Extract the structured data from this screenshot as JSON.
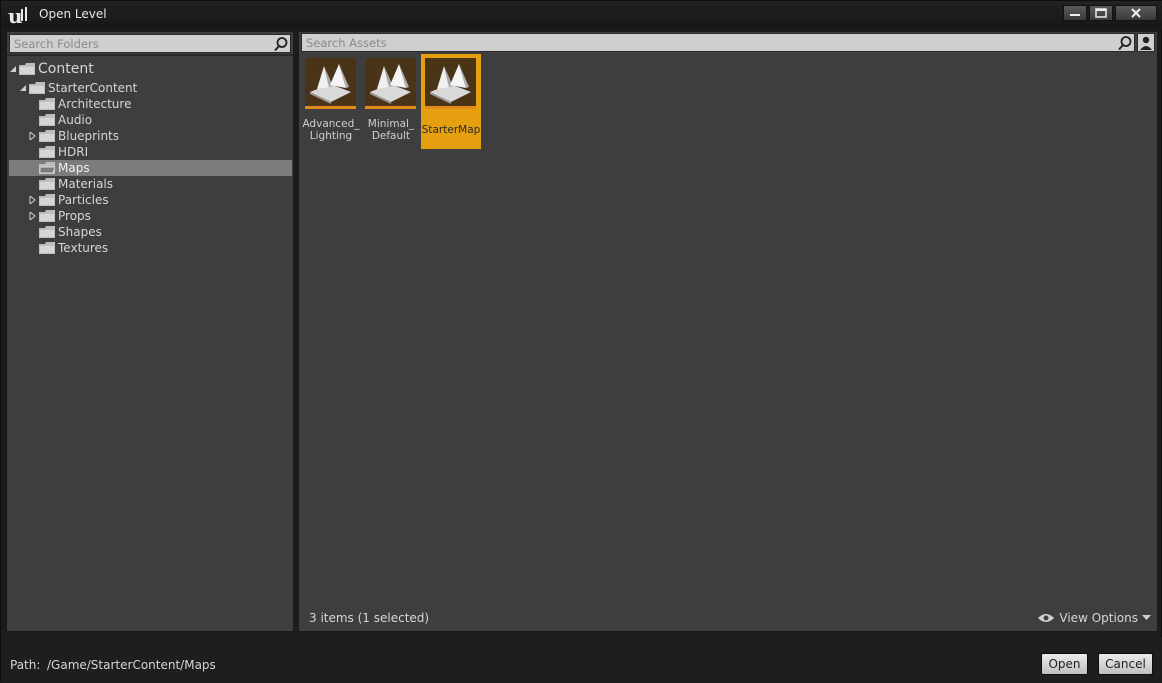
{
  "window": {
    "title": "Open Level"
  },
  "folders": {
    "search_placeholder": "Search Folders",
    "tree": [
      {
        "label": "Content"
      },
      {
        "label": "StarterContent"
      },
      {
        "label": "Architecture"
      },
      {
        "label": "Audio"
      },
      {
        "label": "Blueprints"
      },
      {
        "label": "HDRI"
      },
      {
        "label": "Maps"
      },
      {
        "label": "Materials"
      },
      {
        "label": "Particles"
      },
      {
        "label": "Props"
      },
      {
        "label": "Shapes"
      },
      {
        "label": "Textures"
      }
    ]
  },
  "assets": {
    "search_placeholder": "Search Assets",
    "items": [
      {
        "line1": "Advanced_",
        "line2": "Lighting"
      },
      {
        "line1": "Minimal_",
        "line2": "Default"
      },
      {
        "line1": "StarterMap",
        "line2": ""
      }
    ],
    "status": "3 items (1 selected)",
    "view_options": "View Options"
  },
  "footer": {
    "path_label": "Path:",
    "path_value": "/Game/StarterContent/Maps",
    "open_label": "Open",
    "cancel_label": "Cancel"
  },
  "icons": {
    "app": "unreal-logo-icon",
    "minimize": "minimize-icon",
    "maximize": "maximize-icon",
    "close": "close-icon",
    "search": "search-icon",
    "user": "user-icon",
    "folder": "folder-icon",
    "eye": "eye-icon"
  },
  "colors": {
    "selection": "#e6a00f",
    "panel": "#3e3e3e",
    "tree_selected": "#7c7c7c"
  }
}
